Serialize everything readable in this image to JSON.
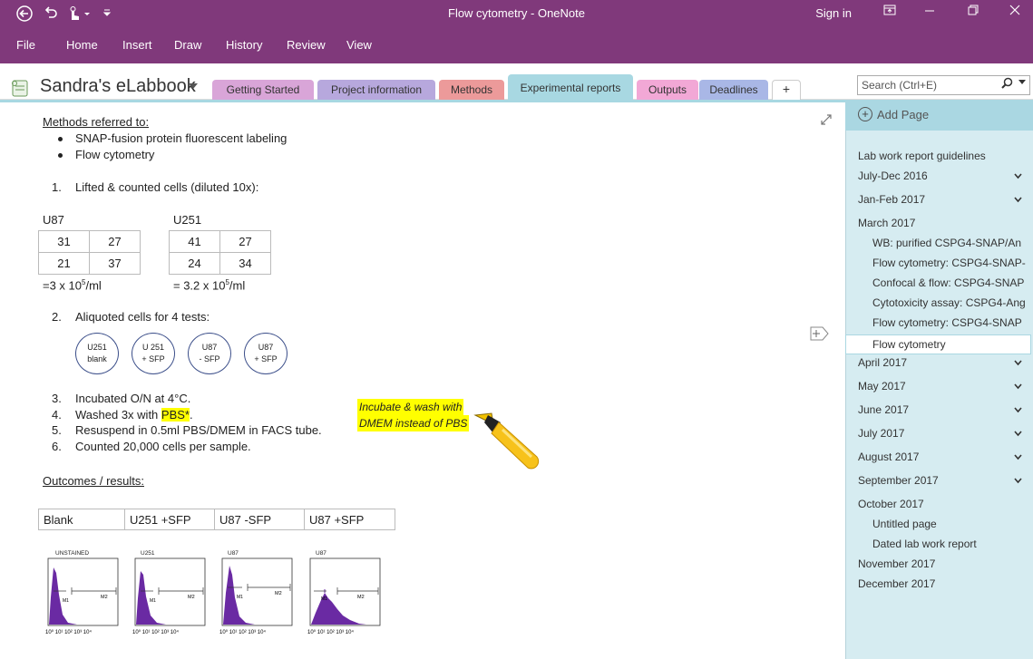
{
  "titlebar": {
    "title": "Flow cytometry - OneNote",
    "signin": "Sign in"
  },
  "ribbon": {
    "tabs": [
      "File",
      "Home",
      "Insert",
      "Draw",
      "History",
      "Review",
      "View"
    ]
  },
  "notebook": {
    "name": "Sandra's eLabbook",
    "sections": [
      {
        "label": "Getting Started",
        "color": "#d9a5d8"
      },
      {
        "label": "Project information",
        "color": "#b7a8dd"
      },
      {
        "label": "Methods",
        "color": "#ec9a9a"
      },
      {
        "label": "Experimental reports",
        "color": "#a8d8e2"
      },
      {
        "label": "Outputs",
        "color": "#f2a8d6"
      },
      {
        "label": "Deadlines",
        "color": "#a9b7e6"
      }
    ],
    "add_section": "+"
  },
  "search": {
    "placeholder": "Search (Ctrl+E)"
  },
  "page": {
    "methods_heading": "Methods referred to:",
    "methods_bullets": [
      "SNAP-fusion protein fluorescent labeling",
      "Flow cytometry"
    ],
    "step1": {
      "num": "1.",
      "text": "Lifted & counted cells (diluted 10x):"
    },
    "u87": {
      "label": "U87",
      "cells": [
        [
          "31",
          "27"
        ],
        [
          "21",
          "37"
        ]
      ],
      "result": "=3 x 10",
      "sup": "5",
      "unit": "/ml"
    },
    "u251": {
      "label": "U251",
      "cells": [
        [
          "41",
          "27"
        ],
        [
          "24",
          "34"
        ]
      ],
      "result": "= 3.2 x 10",
      "sup": "5",
      "unit": "/ml"
    },
    "step2": {
      "num": "2.",
      "text": "Aliquoted cells for 4 tests:"
    },
    "tests": [
      {
        "l1": "U251",
        "l2": "blank"
      },
      {
        "l1": "U 251",
        "l2": "+ SFP"
      },
      {
        "l1": "U87",
        "l2": "- SFP"
      },
      {
        "l1": "U87",
        "l2": "+ SFP"
      }
    ],
    "step3": {
      "num": "3.",
      "text": "Incubated O/N at 4°C."
    },
    "step4": {
      "num": "4.",
      "pre": "Washed 3x with ",
      "hl": "PBS*",
      "post": "."
    },
    "step5": {
      "num": "5.",
      "text": "Resuspend in 0.5ml PBS/DMEM in FACS tube."
    },
    "step6": {
      "num": "6.",
      "text": "Counted 20,000 cells per sample."
    },
    "sticky": [
      "Incubate & wash with",
      "DMEM instead of PBS"
    ],
    "outcomes_heading": "Outcomes / results:",
    "outcomes_cols": [
      "Blank",
      "U251 +SFP",
      "U87 -SFP",
      "U87 +SFP"
    ],
    "histograms": [
      {
        "label": "UNSTAINED",
        "m1": "M1",
        "m2": "M2"
      },
      {
        "label": "U251",
        "m1": "M1",
        "m2": "M2"
      },
      {
        "label": "U87",
        "m1": "M1",
        "m2": "M2"
      },
      {
        "label": "U87",
        "m1": "M1",
        "m2": "M2"
      }
    ]
  },
  "pages": {
    "add_label": "Add Page",
    "items": [
      {
        "label": "Lab work report guidelines",
        "sub": false,
        "chev": false
      },
      {
        "label": "July-Dec 2016",
        "sub": false,
        "chev": true
      },
      {
        "label": "Jan-Feb 2017",
        "sub": false,
        "chev": true
      },
      {
        "label": "March 2017",
        "sub": false,
        "chev": false
      },
      {
        "label": "WB: purified CSPG4-SNAP/An",
        "sub": true,
        "chev": false
      },
      {
        "label": "Flow cytometry: CSPG4-SNAP-",
        "sub": true,
        "chev": false
      },
      {
        "label": "Confocal & flow: CSPG4-SNAP",
        "sub": true,
        "chev": false
      },
      {
        "label": "Cytotoxicity assay: CSPG4-Ang",
        "sub": true,
        "chev": false
      },
      {
        "label": "Flow cytometry: CSPG4-SNAP",
        "sub": true,
        "chev": false
      },
      {
        "label": "Flow cytometry",
        "sub": true,
        "chev": false,
        "selected": true
      },
      {
        "label": "April 2017",
        "sub": false,
        "chev": true
      },
      {
        "label": "May 2017",
        "sub": false,
        "chev": true
      },
      {
        "label": "June 2017",
        "sub": false,
        "chev": true
      },
      {
        "label": "July 2017",
        "sub": false,
        "chev": true
      },
      {
        "label": "August 2017",
        "sub": false,
        "chev": true
      },
      {
        "label": "September 2017",
        "sub": false,
        "chev": true
      },
      {
        "label": "October 2017",
        "sub": false,
        "chev": false
      },
      {
        "label": "Untitled page",
        "sub": true,
        "chev": false
      },
      {
        "label": "Dated lab work report",
        "sub": true,
        "chev": false
      },
      {
        "label": "November 2017",
        "sub": false,
        "chev": false
      },
      {
        "label": "December 2017",
        "sub": false,
        "chev": false
      }
    ]
  },
  "colors": {
    "ribbon": "#80397B",
    "page_pane": "#d6ecf1",
    "highlight": "#ffff00"
  }
}
